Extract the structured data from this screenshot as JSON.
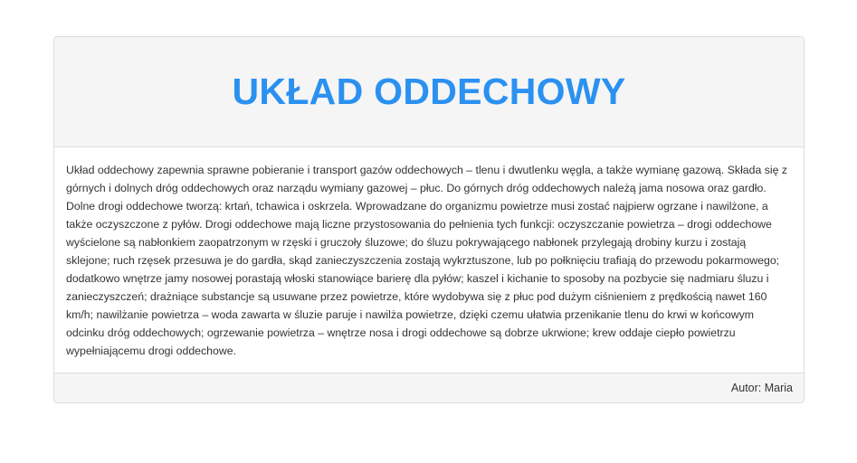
{
  "header": {
    "title": "UKŁAD ODDECHOWY"
  },
  "body": {
    "text": "Układ oddechowy zapewnia sprawne pobieranie i transport gazów oddechowych – tlenu i dwutlenku węgla, a także wymianę gazową. Składa się z górnych i dolnych dróg oddechowych oraz narządu wymiany gazowej – płuc. Do górnych dróg oddechowych należą jama nosowa oraz gardło. Dolne drogi oddechowe tworzą: krtań, tchawica i oskrzela. Wprowadzane do organizmu powietrze musi zostać najpierw ogrzane i nawilżone, a także oczyszczone z pyłów. Drogi oddechowe mają liczne przystosowania do pełnienia tych funkcji: oczyszczanie powietrza – drogi oddechowe wyścielone są nabłonkiem zaopatrzonym w rzęski i gruczoły śluzowe; do śluzu pokrywającego nabłonek przylegają drobiny kurzu i zostają sklejone; ruch rzęsek przesuwa je do gardła, skąd zanieczyszczenia zostają wykrztuszone, lub po połknięciu trafiają do przewodu pokarmowego; dodatkowo wnętrze jamy nosowej porastają włoski stanowiące barierę dla pyłów; kaszel i kichanie to sposoby na pozbycie się nadmiaru śluzu i zanieczyszczeń; drażniące substancje są usuwane przez powietrze, które wydobywa się z płuc pod dużym ciśnieniem z prędkością nawet 160 km/h; nawilżanie powietrza – woda zawarta w śluzie paruje i nawilża powietrze, dzięki czemu ułatwia przenikanie tlenu do krwi w końcowym odcinku dróg oddechowych; ogrzewanie powietrza – wnętrze nosa i drogi oddechowe są dobrze ukrwione; krew oddaje ciepło powietrzu wypełniającemu drogi oddechowe."
  },
  "footer": {
    "author": "Autor: Maria"
  },
  "colors": {
    "title": "#2b91f0",
    "panel_bg": "#f5f5f5",
    "border": "#dddddd",
    "text": "#333333"
  }
}
